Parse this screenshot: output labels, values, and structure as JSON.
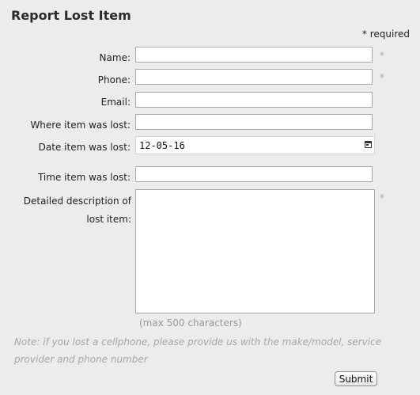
{
  "form": {
    "title": "Report Lost Item",
    "required_note": "* required",
    "required_marker": "*",
    "fields": {
      "name": {
        "label": "Name:",
        "value": "",
        "required": true
      },
      "phone": {
        "label": "Phone:",
        "value": "",
        "required": true
      },
      "email": {
        "label": "Email:",
        "value": "",
        "required": false
      },
      "where_lost": {
        "label": "Where item was lost:",
        "value": "",
        "required": false
      },
      "date_lost": {
        "label": "Date item was lost:",
        "value": "12-05-16",
        "required": false
      },
      "time_lost": {
        "label": "Time item was lost:",
        "value": "",
        "required": false
      },
      "description": {
        "label": "Detailed description of lost item:",
        "value": "",
        "required": true
      }
    },
    "max_chars_hint": "(max 500 characters)",
    "note": "Note: if you lost a cellphone, please provide us with the make/model, service provider and phone number",
    "submit_label": "Submit"
  },
  "icons": {
    "date_picker": "calendar-icon"
  }
}
